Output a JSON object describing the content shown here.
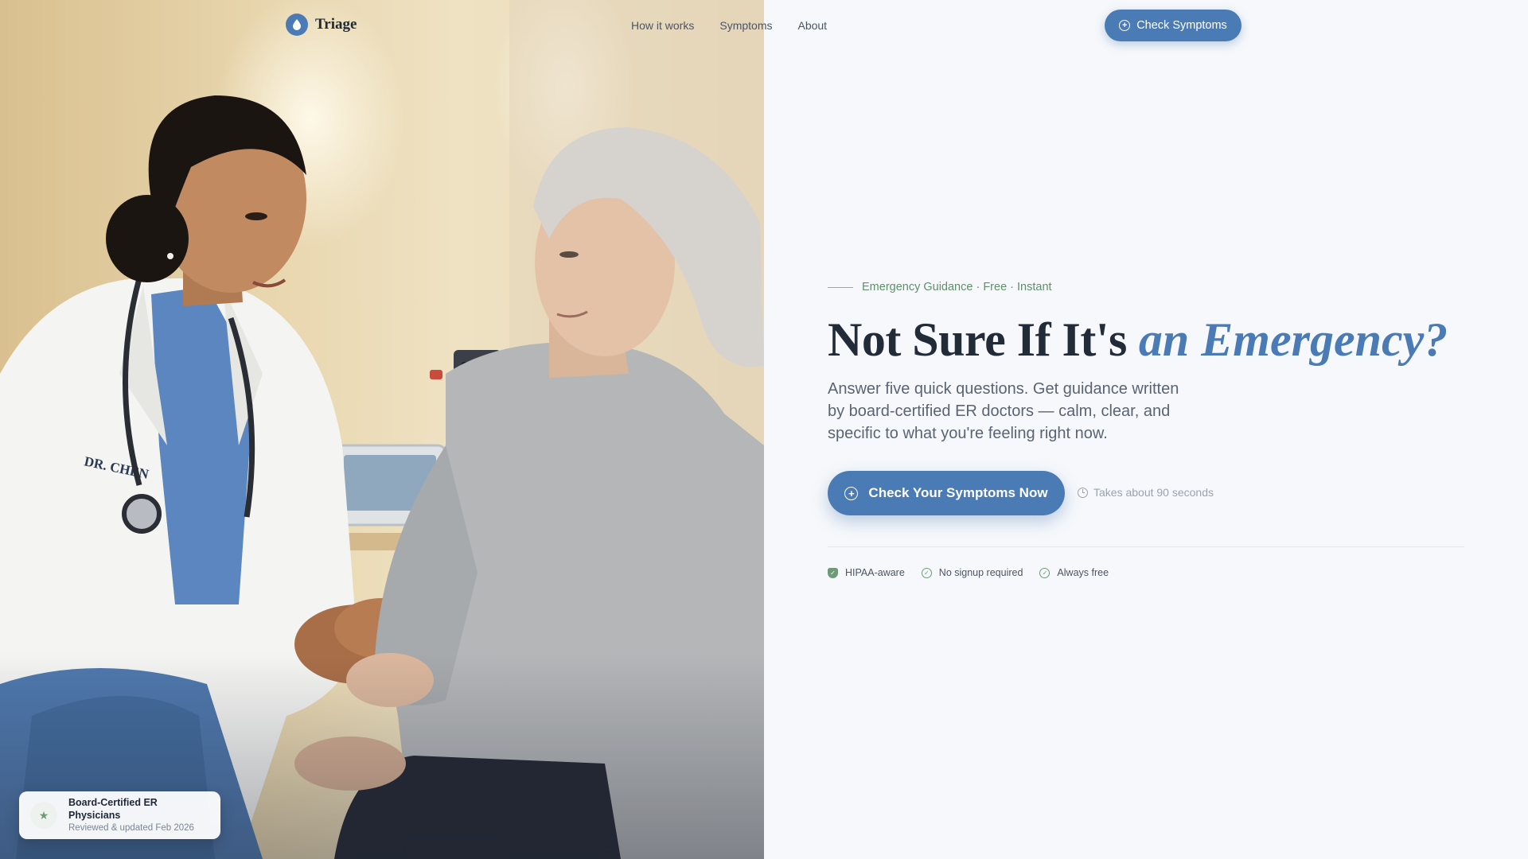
{
  "nav": {
    "brand": "Triage",
    "links": [
      "How it works",
      "Symptoms",
      "About"
    ],
    "cta_label": "Check Symptoms"
  },
  "hero": {
    "eyebrow": "Emergency Guidance · Free · Instant",
    "headline_main": "Not Sure If It's",
    "headline_accent": "an Emergency?",
    "lead": "Answer five quick questions. Get guidance written by board-certified ER doctors — calm, clear, and specific to what you're feeling right now.",
    "cta_label": "Check Your Symptoms Now",
    "time_note": "Takes about 90 seconds",
    "trust": [
      {
        "icon": "shield-check-icon",
        "label": "HIPAA-aware"
      },
      {
        "icon": "check-circle-icon",
        "label": "No signup required"
      },
      {
        "icon": "check-circle-icon",
        "label": "Always free"
      }
    ]
  },
  "photo": {
    "badge_title": "Board-Certified ER Physicians",
    "badge_subtitle": "Reviewed & updated Feb 2026",
    "badge_icon": "star-icon"
  },
  "colors": {
    "accent": "#4a7bb5",
    "green": "#6f9a78",
    "background": "#f6f8fb",
    "heading": "#222b38"
  }
}
